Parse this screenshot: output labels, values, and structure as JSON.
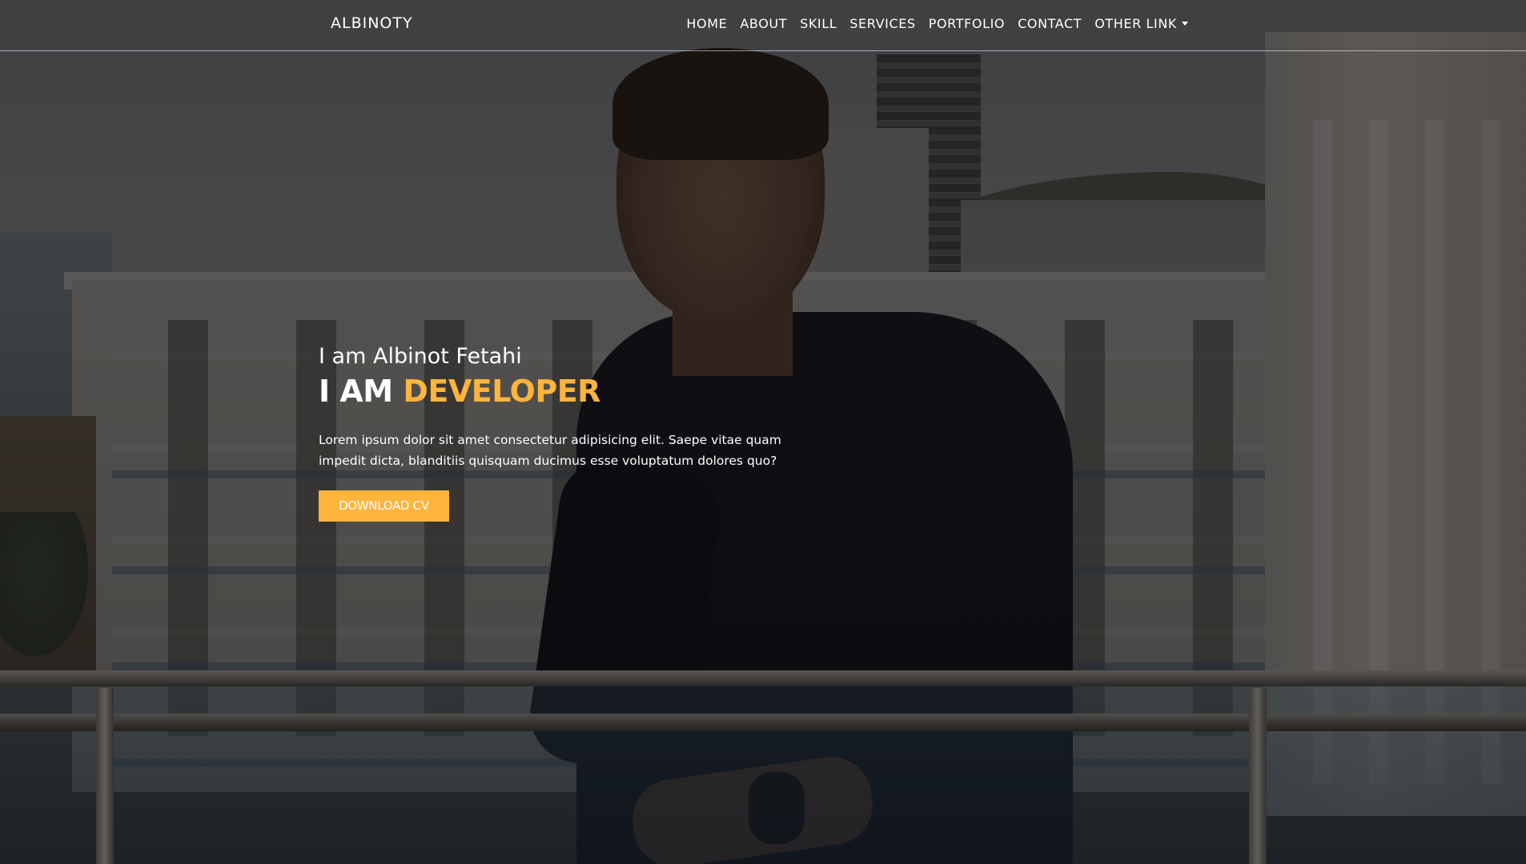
{
  "navbar": {
    "brand": "ALBINOTY",
    "links": [
      {
        "label": "HOME"
      },
      {
        "label": "ABOUT"
      },
      {
        "label": "SKILL"
      },
      {
        "label": "SERVICES"
      },
      {
        "label": "PORTFOLIO"
      },
      {
        "label": "CONTACT"
      },
      {
        "label": "OTHER LINK",
        "dropdown": true
      }
    ]
  },
  "hero": {
    "intro": "I am Albinot Fetahi",
    "role_prefix": "I AM",
    "role_highlight": "DEVELOPER",
    "description": "Lorem ipsum dolor sit amet consectetur adipisicing elit. Saepe vitae quam impedit dicta, blanditiis quisquam ducimus esse voluptatum dolores quo?",
    "button_label": "DOWNLOAD CV"
  },
  "colors": {
    "accent": "#ffb43c",
    "text": "#ffffff",
    "overlay": "rgba(0,0,0,0.42)"
  }
}
